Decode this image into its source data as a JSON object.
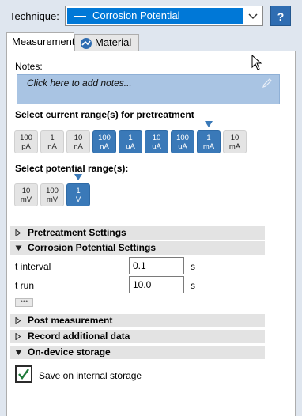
{
  "technique": {
    "label": "Technique:",
    "selected": "Corrosion Potential",
    "help_label": "?"
  },
  "tabs": [
    {
      "label": "Measurement",
      "active": true
    },
    {
      "label": "Material",
      "active": false
    }
  ],
  "notes": {
    "label": "Notes:",
    "placeholder": "Click here to add notes..."
  },
  "current_ranges": {
    "title": "Select current range(s) for pretreatment",
    "items": [
      {
        "value": "100",
        "unit": "pA",
        "selected": false
      },
      {
        "value": "1",
        "unit": "nA",
        "selected": false
      },
      {
        "value": "10",
        "unit": "nA",
        "selected": false
      },
      {
        "value": "100",
        "unit": "nA",
        "selected": true
      },
      {
        "value": "1",
        "unit": "uA",
        "selected": true
      },
      {
        "value": "10",
        "unit": "uA",
        "selected": true
      },
      {
        "value": "100",
        "unit": "uA",
        "selected": true
      },
      {
        "value": "1",
        "unit": "mA",
        "selected": true,
        "marker": true
      },
      {
        "value": "10",
        "unit": "mA",
        "selected": false
      }
    ]
  },
  "potential_ranges": {
    "title": "Select potential range(s):",
    "items": [
      {
        "value": "10",
        "unit": "mV",
        "selected": false
      },
      {
        "value": "100",
        "unit": "mV",
        "selected": false
      },
      {
        "value": "1",
        "unit": "V",
        "selected": true,
        "marker": true
      }
    ]
  },
  "groups": {
    "pretreatment": "Pretreatment Settings",
    "corrosion": "Corrosion Potential Settings",
    "post": "Post measurement",
    "record": "Record additional data",
    "storage": "On-device storage"
  },
  "fields": {
    "t_interval": {
      "label": "t interval",
      "value": "0.1",
      "unit": "s"
    },
    "t_run": {
      "label": "t run",
      "value": "10.0",
      "unit": "s"
    }
  },
  "more_button": "•••",
  "storage": {
    "save_label": "Save on internal storage",
    "checked": true
  },
  "colors": {
    "accent": "#0078d7",
    "selected_range": "#3a79b8",
    "notes_bg": "#a9c4e3"
  }
}
